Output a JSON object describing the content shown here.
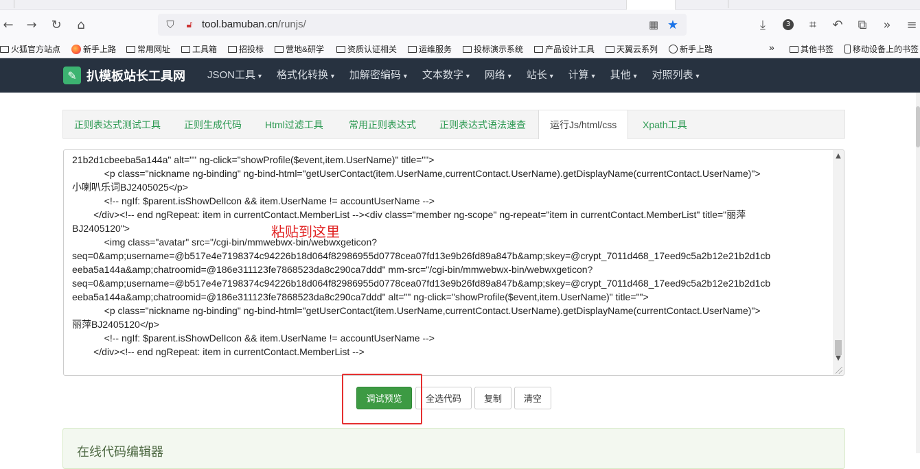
{
  "browser": {
    "url_host": "tool.bamuban.cn",
    "url_path": "/runjs/",
    "extensions_badge": "3"
  },
  "bookmarks": [
    {
      "label": "火狐官方站点",
      "icon": "folder-icon"
    },
    {
      "label": "新手上路",
      "icon": "firefox-icon"
    },
    {
      "label": "常用网址",
      "icon": "folder-icon"
    },
    {
      "label": "工具箱",
      "icon": "folder-icon"
    },
    {
      "label": "招投标",
      "icon": "folder-icon"
    },
    {
      "label": "营地&研学",
      "icon": "folder-icon"
    },
    {
      "label": "资质认证相关",
      "icon": "folder-icon"
    },
    {
      "label": "运维服务",
      "icon": "folder-icon"
    },
    {
      "label": "投标演示系统",
      "icon": "folder-icon"
    },
    {
      "label": "产品设计工具",
      "icon": "folder-icon"
    },
    {
      "label": "天翼云系列",
      "icon": "folder-icon"
    },
    {
      "label": "新手上路",
      "icon": "globe-icon"
    }
  ],
  "bookmarks_right": [
    {
      "label": "其他书签",
      "icon": "folder-icon"
    },
    {
      "label": "移动设备上的书签",
      "icon": "phone-icon"
    }
  ],
  "site": {
    "brand": "扒模板站长工具网",
    "menu": [
      "JSON工具",
      "格式化转换",
      "加解密编码",
      "文本数字",
      "网络",
      "站长",
      "计算",
      "其他",
      "对照列表"
    ]
  },
  "tabs": [
    "正则表达式测试工具",
    "正则生成代码",
    "Html过滤工具",
    "常用正则表达式",
    "正则表达式语法速查",
    "运行Js/html/css",
    "Xpath工具"
  ],
  "active_tab": "运行Js/html/css",
  "code_lines": [
    "21b2d1cbeeba5a144a\" alt=\"\" ng-click=\"showProfile($event,item.UserName)\" title=\"\">",
    "            <p class=\"nickname ng-binding\" ng-bind-html=\"getUserContact(item.UserName,currentContact.UserName).getDisplayName(currentContact.UserName)\">",
    "小喇叭乐词BJ2405025</p>",
    "            <!-- ngIf: $parent.isShowDelIcon && item.UserName != accountUserName -->",
    "        </div><!-- end ngRepeat: item in currentContact.MemberList --><div class=\"member ng-scope\" ng-repeat=\"item in currentContact.MemberList\" title=\"丽萍",
    "BJ2405120\">",
    "            <img class=\"avatar\" src=\"/cgi-bin/mmwebwx-bin/webwxgeticon?",
    "seq=0&amp;username=@b517e4e7198374c94226b18d064f82986955d0778cea07fd13e9b26fd89a847b&amp;skey=@crypt_7011d468_17eed9c5a2b12e21b2d1cb",
    "eeba5a144a&amp;chatroomid=@186e311123fe7868523da8c290ca7ddd\" mm-src=\"/cgi-bin/mmwebwx-bin/webwxgeticon?",
    "seq=0&amp;username=@b517e4e7198374c94226b18d064f82986955d0778cea07fd13e9b26fd89a847b&amp;skey=@crypt_7011d468_17eed9c5a2b12e21b2d1cb",
    "eeba5a144a&amp;chatroomid=@186e311123fe7868523da8c290ca7ddd\" alt=\"\" ng-click=\"showProfile($event,item.UserName)\" title=\"\">",
    "            <p class=\"nickname ng-binding\" ng-bind-html=\"getUserContact(item.UserName,currentContact.UserName).getDisplayName(currentContact.UserName)\">",
    "丽萍BJ2405120</p>",
    "            <!-- ngIf: $parent.isShowDelIcon && item.UserName != accountUserName -->",
    "        </div><!-- end ngRepeat: item in currentContact.MemberList -->"
  ],
  "annotation": "粘贴到这里",
  "buttons": {
    "preview": "调试预览",
    "select_all": "全选代码",
    "copy": "复制",
    "clear": "清空"
  },
  "bottom_panel_title": "在线代码编辑器",
  "colors": {
    "header_bg": "#273240",
    "tab_green": "#2e9a53",
    "primary_button": "#3d9a43",
    "annotation_red": "#e02020"
  }
}
